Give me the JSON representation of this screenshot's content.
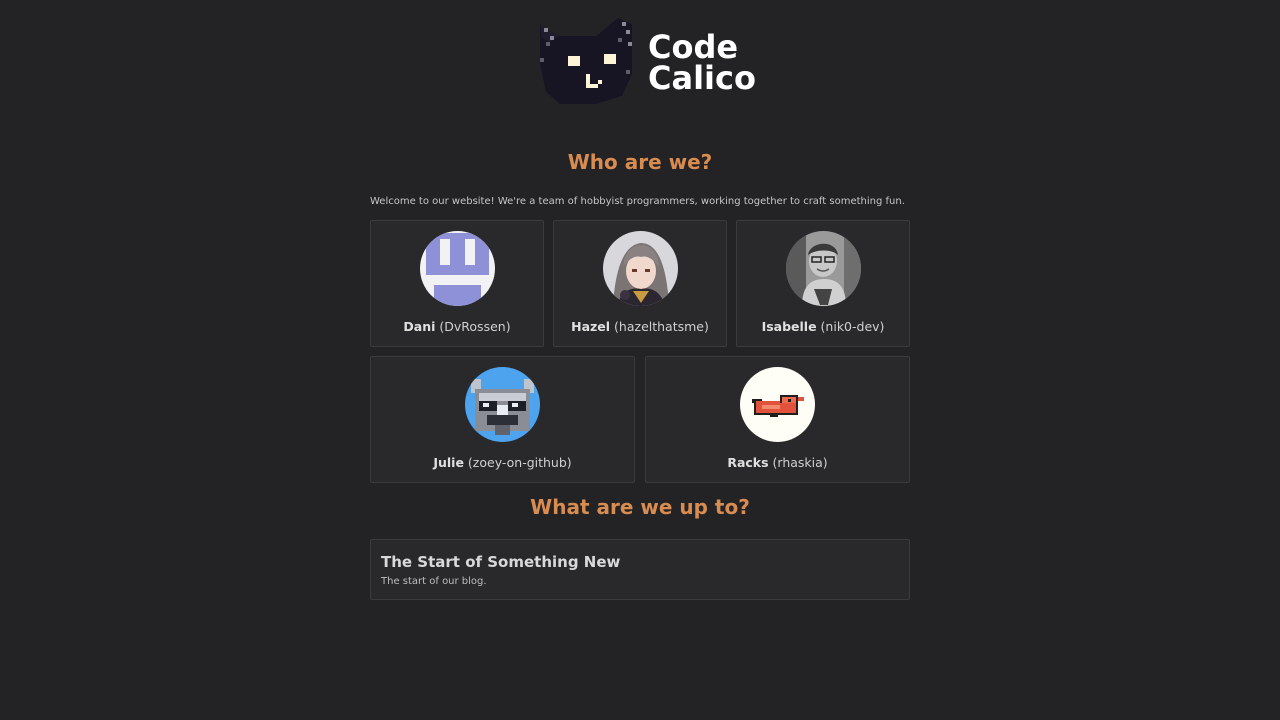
{
  "brand": {
    "line1": "Code",
    "line2": "Calico"
  },
  "about": {
    "heading": "Who are we?",
    "intro": "Welcome to our website! We're a team of hobbyist programmers, working together to craft something fun."
  },
  "members": [
    {
      "name": "Dani",
      "handle": "(DvRossen)"
    },
    {
      "name": "Hazel",
      "handle": "(hazelthatsme)"
    },
    {
      "name": "Isabelle",
      "handle": "(nik0-dev)"
    },
    {
      "name": "Julie",
      "handle": "(zoey-on-github)"
    },
    {
      "name": "Racks",
      "handle": "(rhaskia)"
    }
  ],
  "blog": {
    "heading": "What are we up to?",
    "posts": [
      {
        "title": "The Start of Something New",
        "description": "The start of our blog."
      }
    ]
  },
  "colors": {
    "background": "#232326",
    "card": "#29292c",
    "accent": "#d98c4f"
  }
}
